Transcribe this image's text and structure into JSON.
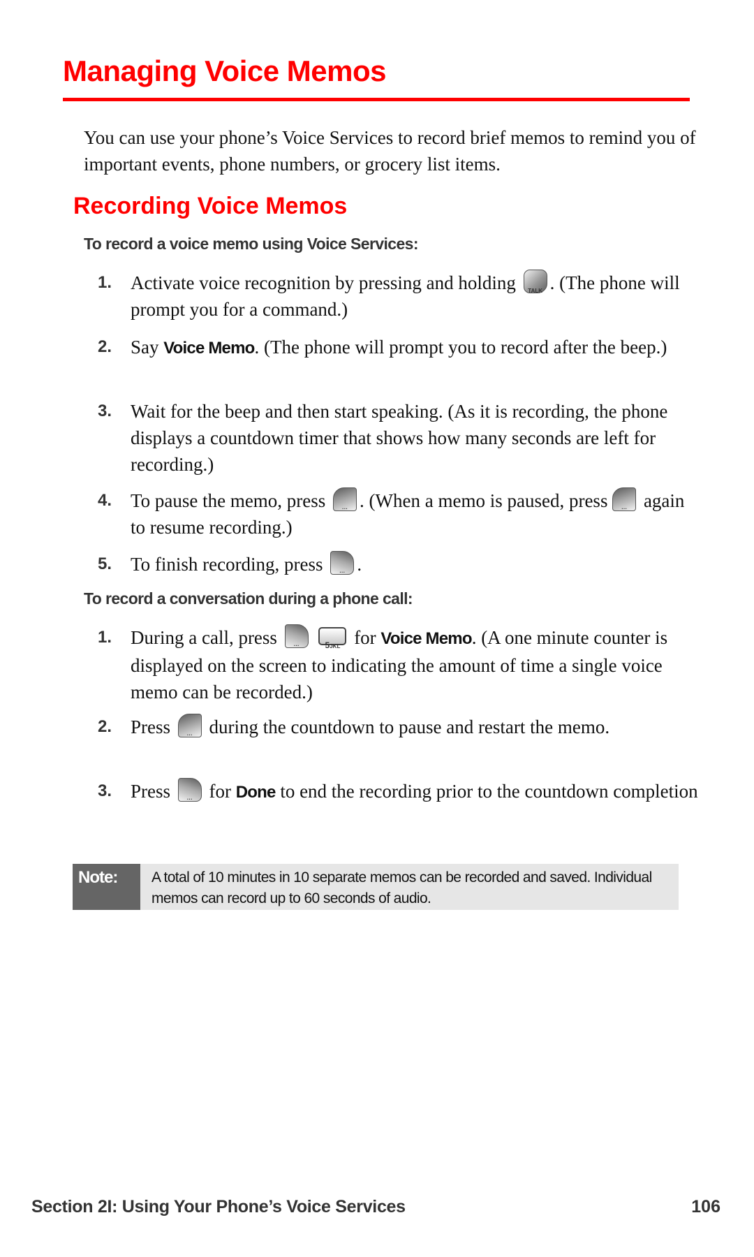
{
  "page": {
    "title": "Managing Voice Memos",
    "intro": "You can use your phone’s Voice Services to record brief memos to remind you of important events, phone numbers, or grocery list items.",
    "section_title": "Recording Voice Memos",
    "accent_color": "#ff0000"
  },
  "procedure1": {
    "heading": "To record a voice memo using Voice Services:",
    "steps": [
      {
        "num": "1.",
        "parts": [
          "Activate voice recognition by pressing and holding ",
          ". (The phone will prompt you for a command.)"
        ],
        "key": "TALK"
      },
      {
        "num": "2.",
        "pre": "Say ",
        "bold": "Voice Memo",
        "post": ". (The phone will prompt you to record after the beep.)"
      },
      {
        "num": "3.",
        "text": "Wait for the beep and then start speaking. (As it is recording, the phone displays a countdown timer that shows how many seconds are left for recording.)"
      },
      {
        "num": "4.",
        "parts": [
          "To pause the memo, press ",
          ". (When a memo is paused, press ",
          " again to resume recording.)"
        ]
      },
      {
        "num": "5.",
        "parts": [
          "To finish recording, press ",
          "."
        ]
      }
    ]
  },
  "procedure2": {
    "heading": "To record a conversation during a phone call:",
    "steps": [
      {
        "num": "1.",
        "parts": [
          "During a call, press ",
          " for ",
          ". (A one minute counter is displayed on the screen to indicating the amount of time a single voice memo can be recorded.)"
        ],
        "bold": "Voice Memo",
        "key_digit": "5",
        "key_letters": "JKL"
      },
      {
        "num": "2.",
        "parts": [
          "Press ",
          " during the countdown to pause and restart the memo."
        ]
      },
      {
        "num": "3.",
        "parts": [
          "Press ",
          " for ",
          " to end the recording prior to the countdown completion"
        ],
        "bold": "Done"
      }
    ]
  },
  "note": {
    "label": "Note:",
    "text": "A total of 10 minutes in 10 separate memos can be recorded and saved. Individual memos can record up to 60 seconds of audio."
  },
  "footer": {
    "section": "Section 2I: Using Your Phone’s Voice Services",
    "page_number": "106"
  },
  "icons": {
    "talk_key": "TALK",
    "soft_key": "···"
  }
}
